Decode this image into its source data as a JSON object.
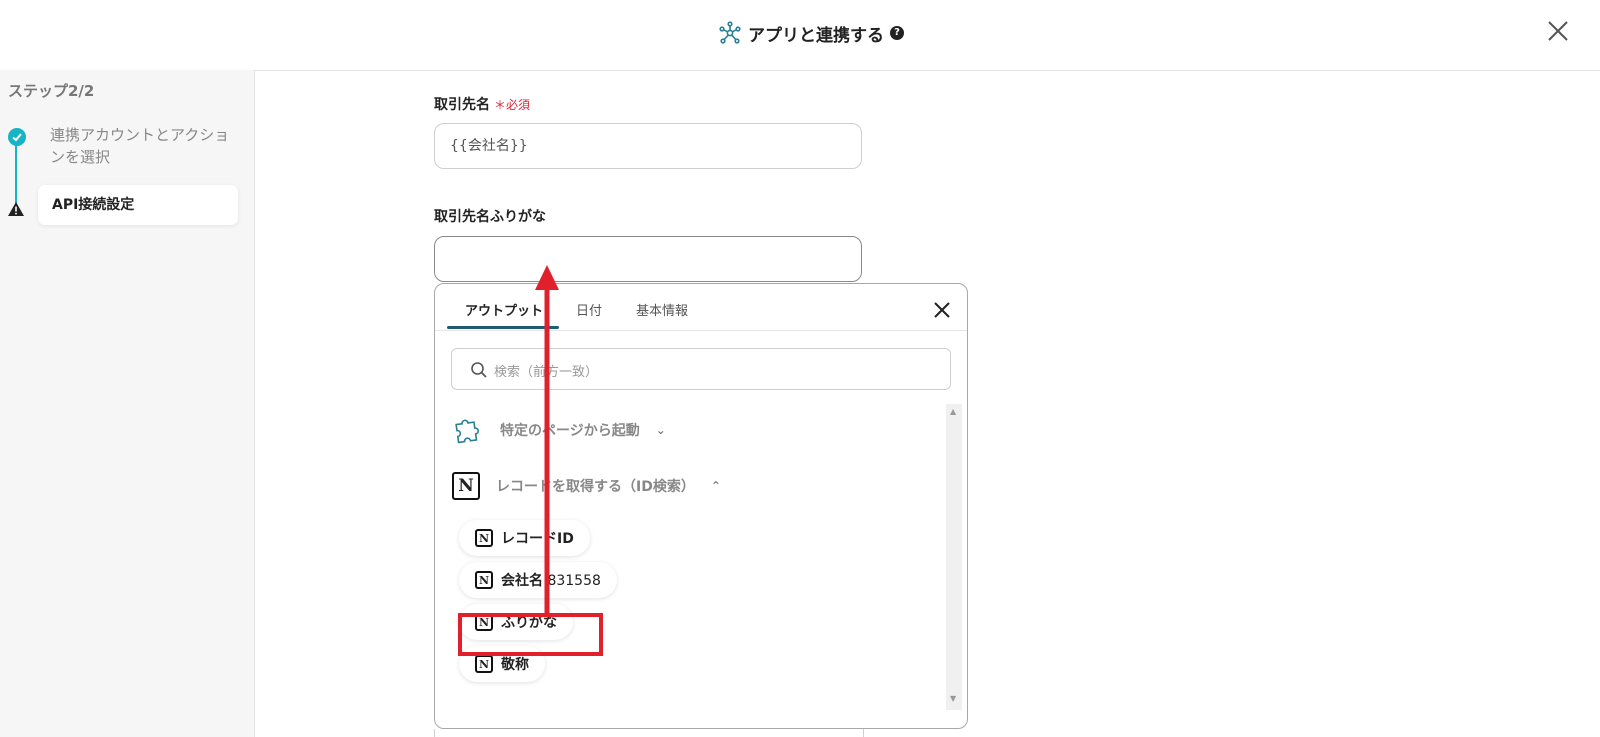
{
  "header": {
    "title": "アプリと連携する",
    "help_glyph": "?",
    "title_icon": "integration-network-icon",
    "close_icon": "close-icon"
  },
  "sidebar": {
    "step_header": "ステップ2/2",
    "steps": [
      {
        "label": "連携アカウントとアクションを選択",
        "status": "done",
        "icon": "check-circle-icon"
      },
      {
        "label": "API接続設定",
        "status": "warning",
        "icon": "warning-icon"
      }
    ],
    "accent_color": "#16b4c4"
  },
  "form": {
    "company_name_label": "取引先名",
    "required_mark": "＊必須",
    "company_name_value": "{{会社名}}",
    "furigana_label": "取引先名ふりがな",
    "furigana_value": ""
  },
  "popup": {
    "tabs": [
      "アウトプット",
      "日付",
      "基本情報"
    ],
    "active_tab": "アウトプット",
    "search_placeholder": "検索（前方一致）",
    "groups": [
      {
        "label": "特定のページから起動",
        "icon": "puzzle-icon",
        "expanded": false
      },
      {
        "label": "レコードを取得する（ID検索）",
        "icon": "notion-icon",
        "expanded": true
      }
    ],
    "items": [
      {
        "name": "レコードID",
        "value": ""
      },
      {
        "name": "会社名",
        "value": "831558"
      },
      {
        "name": "ふりがな",
        "value": ""
      },
      {
        "name": "敬称",
        "value": ""
      }
    ],
    "item_icon_glyph": "N",
    "highlighted_item": "ふりがな"
  },
  "annotation": {
    "highlight_color": "#e0202a"
  }
}
